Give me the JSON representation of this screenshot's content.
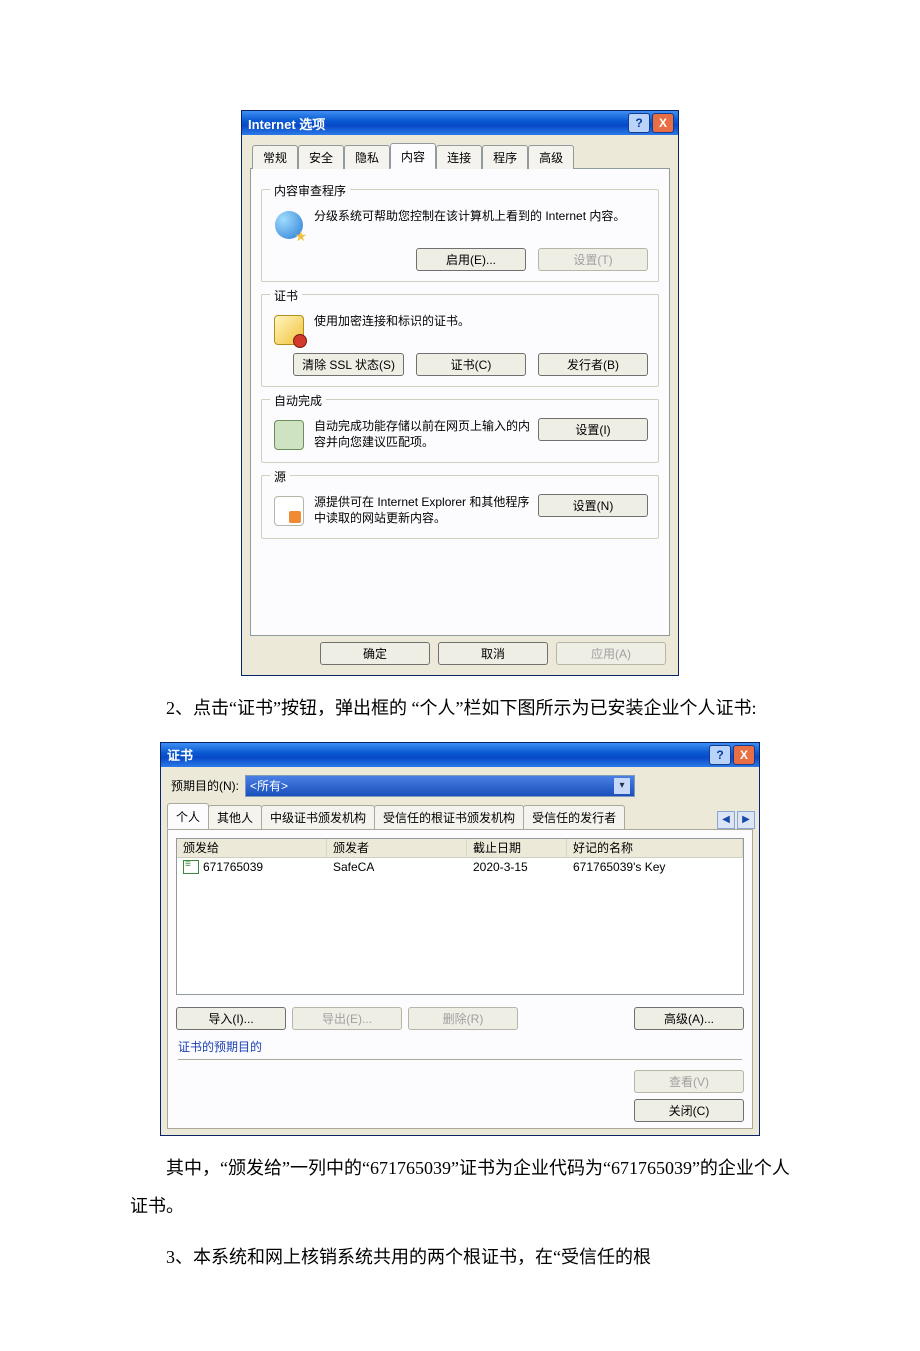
{
  "dialog1": {
    "title": "Internet 选项",
    "help": "?",
    "close": "X",
    "tabs": [
      "常规",
      "安全",
      "隐私",
      "内容",
      "连接",
      "程序",
      "高级"
    ],
    "active_tab_index": 3,
    "groups": {
      "content_advisor": {
        "legend": "内容审查程序",
        "desc": "分级系统可帮助您控制在该计算机上看到的 Internet 内容。",
        "enable_btn": "启用(E)...",
        "settings_btn": "设置(T)"
      },
      "certificates": {
        "legend": "证书",
        "desc": "使用加密连接和标识的证书。",
        "clear_ssl_btn": "清除 SSL 状态(S)",
        "certs_btn": "证书(C)",
        "publishers_btn": "发行者(B)"
      },
      "autocomplete": {
        "legend": "自动完成",
        "desc": "自动完成功能存储以前在网页上输入的内容并向您建议匹配项。",
        "settings_btn": "设置(I)"
      },
      "feeds": {
        "legend": "源",
        "desc": "源提供可在 Internet Explorer 和其他程序中读取的网站更新内容。",
        "settings_btn": "设置(N)"
      }
    },
    "footer": {
      "ok": "确定",
      "cancel": "取消",
      "apply": "应用(A)"
    }
  },
  "narrative1": "2、点击“证书”按钮，弹出框的 “个人”栏如下图所示为已安装企业个人证书:",
  "dialog2": {
    "title": "证书",
    "help": "?",
    "close": "X",
    "purpose_label": "预期目的(N):",
    "purpose_value": "<所有>",
    "tabs": [
      "个人",
      "其他人",
      "中级证书颁发机构",
      "受信任的根证书颁发机构",
      "受信任的发行者"
    ],
    "active_tab_index": 0,
    "columns": {
      "c1": "颁发给",
      "c2": "颁发者",
      "c3": "截止日期",
      "c4": "好记的名称"
    },
    "rows": [
      {
        "c1": "671765039",
        "c2": "SafeCA",
        "c3": "2020-3-15",
        "c4": "671765039's Key"
      }
    ],
    "buttons": {
      "import": "导入(I)...",
      "export": "导出(E)...",
      "remove": "删除(R)",
      "advanced": "高级(A)..."
    },
    "section_label": "证书的预期目的",
    "view_btn": "查看(V)",
    "close_btn": "关闭(C)"
  },
  "narrative2": "其中，“颁发给”一列中的“671765039”证书为企业代码为“671765039”的企业个人证书。",
  "narrative3": "3、本系统和网上核销系统共用的两个根证书，在“受信任的根"
}
